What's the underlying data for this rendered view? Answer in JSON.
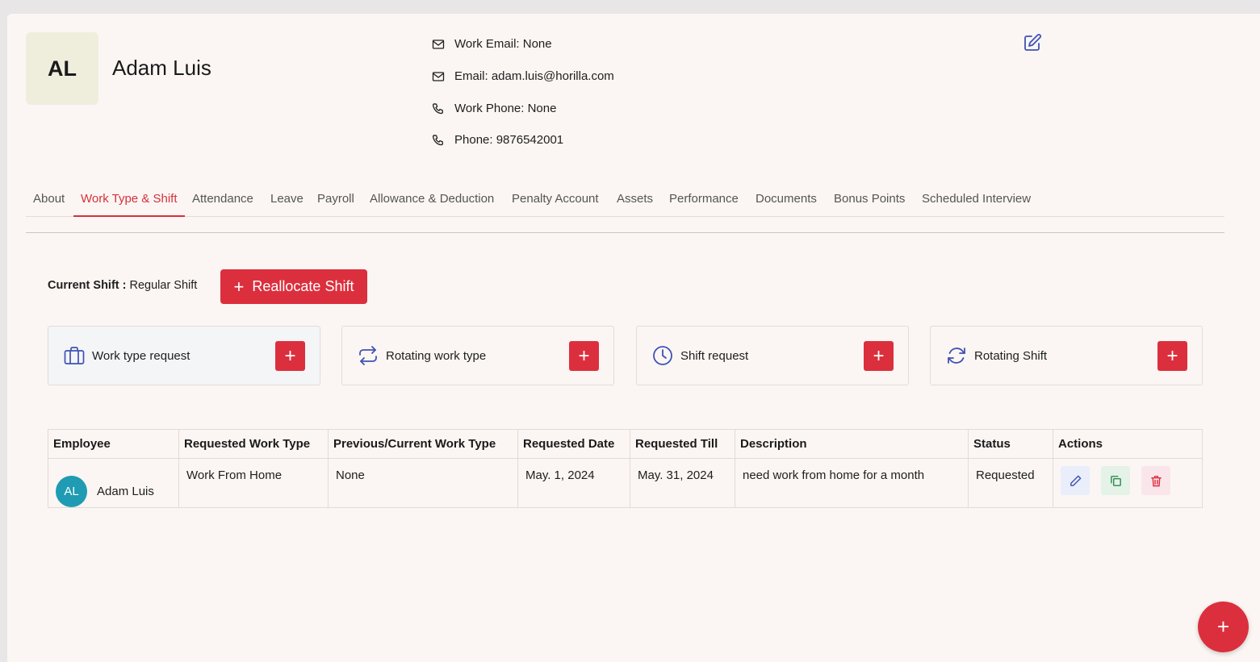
{
  "profile": {
    "initials": "AL",
    "name": "Adam Luis",
    "work_email": "Work Email: None",
    "email": "Email: adam.luis@horilla.com",
    "work_phone": "Work Phone: None",
    "phone": "Phone: 9876542001"
  },
  "tabs": [
    {
      "label": "About"
    },
    {
      "label": "Work Type & Shift",
      "active": true
    },
    {
      "label": "Attendance"
    },
    {
      "label": "Leave"
    },
    {
      "label": "Payroll"
    },
    {
      "label": "Allowance & Deduction"
    },
    {
      "label": "Penalty Account"
    },
    {
      "label": "Assets"
    },
    {
      "label": "Performance"
    },
    {
      "label": "Documents"
    },
    {
      "label": "Bonus Points"
    },
    {
      "label": "Scheduled Interview"
    }
  ],
  "shift": {
    "current_label": "Current Shift :",
    "current_value": "Regular Shift",
    "reallocate_label": "Reallocate Shift"
  },
  "request_cards": [
    {
      "label": "Work type request",
      "icon": "briefcase-icon"
    },
    {
      "label": "Rotating work type",
      "icon": "repeat-icon"
    },
    {
      "label": "Shift request",
      "icon": "clock-icon"
    },
    {
      "label": "Rotating Shift",
      "icon": "refresh-icon"
    }
  ],
  "table": {
    "headers": [
      "Employee",
      "Requested Work Type",
      "Previous/Current Work Type",
      "Requested Date",
      "Requested Till",
      "Description",
      "Status",
      "Actions"
    ],
    "rows": [
      {
        "employee_initials": "AL",
        "employee": "Adam Luis",
        "requested_work_type": "Work From Home",
        "previous_work_type": "None",
        "requested_date": "May. 1, 2024",
        "requested_till": "May. 31, 2024",
        "description": "need work from home for a month",
        "status": "Requested"
      }
    ]
  },
  "colors": {
    "accent": "#dc2f3e",
    "avatar_teal": "#1f9bb3",
    "icon_blue": "#3f51b5"
  },
  "fab_label": "+"
}
